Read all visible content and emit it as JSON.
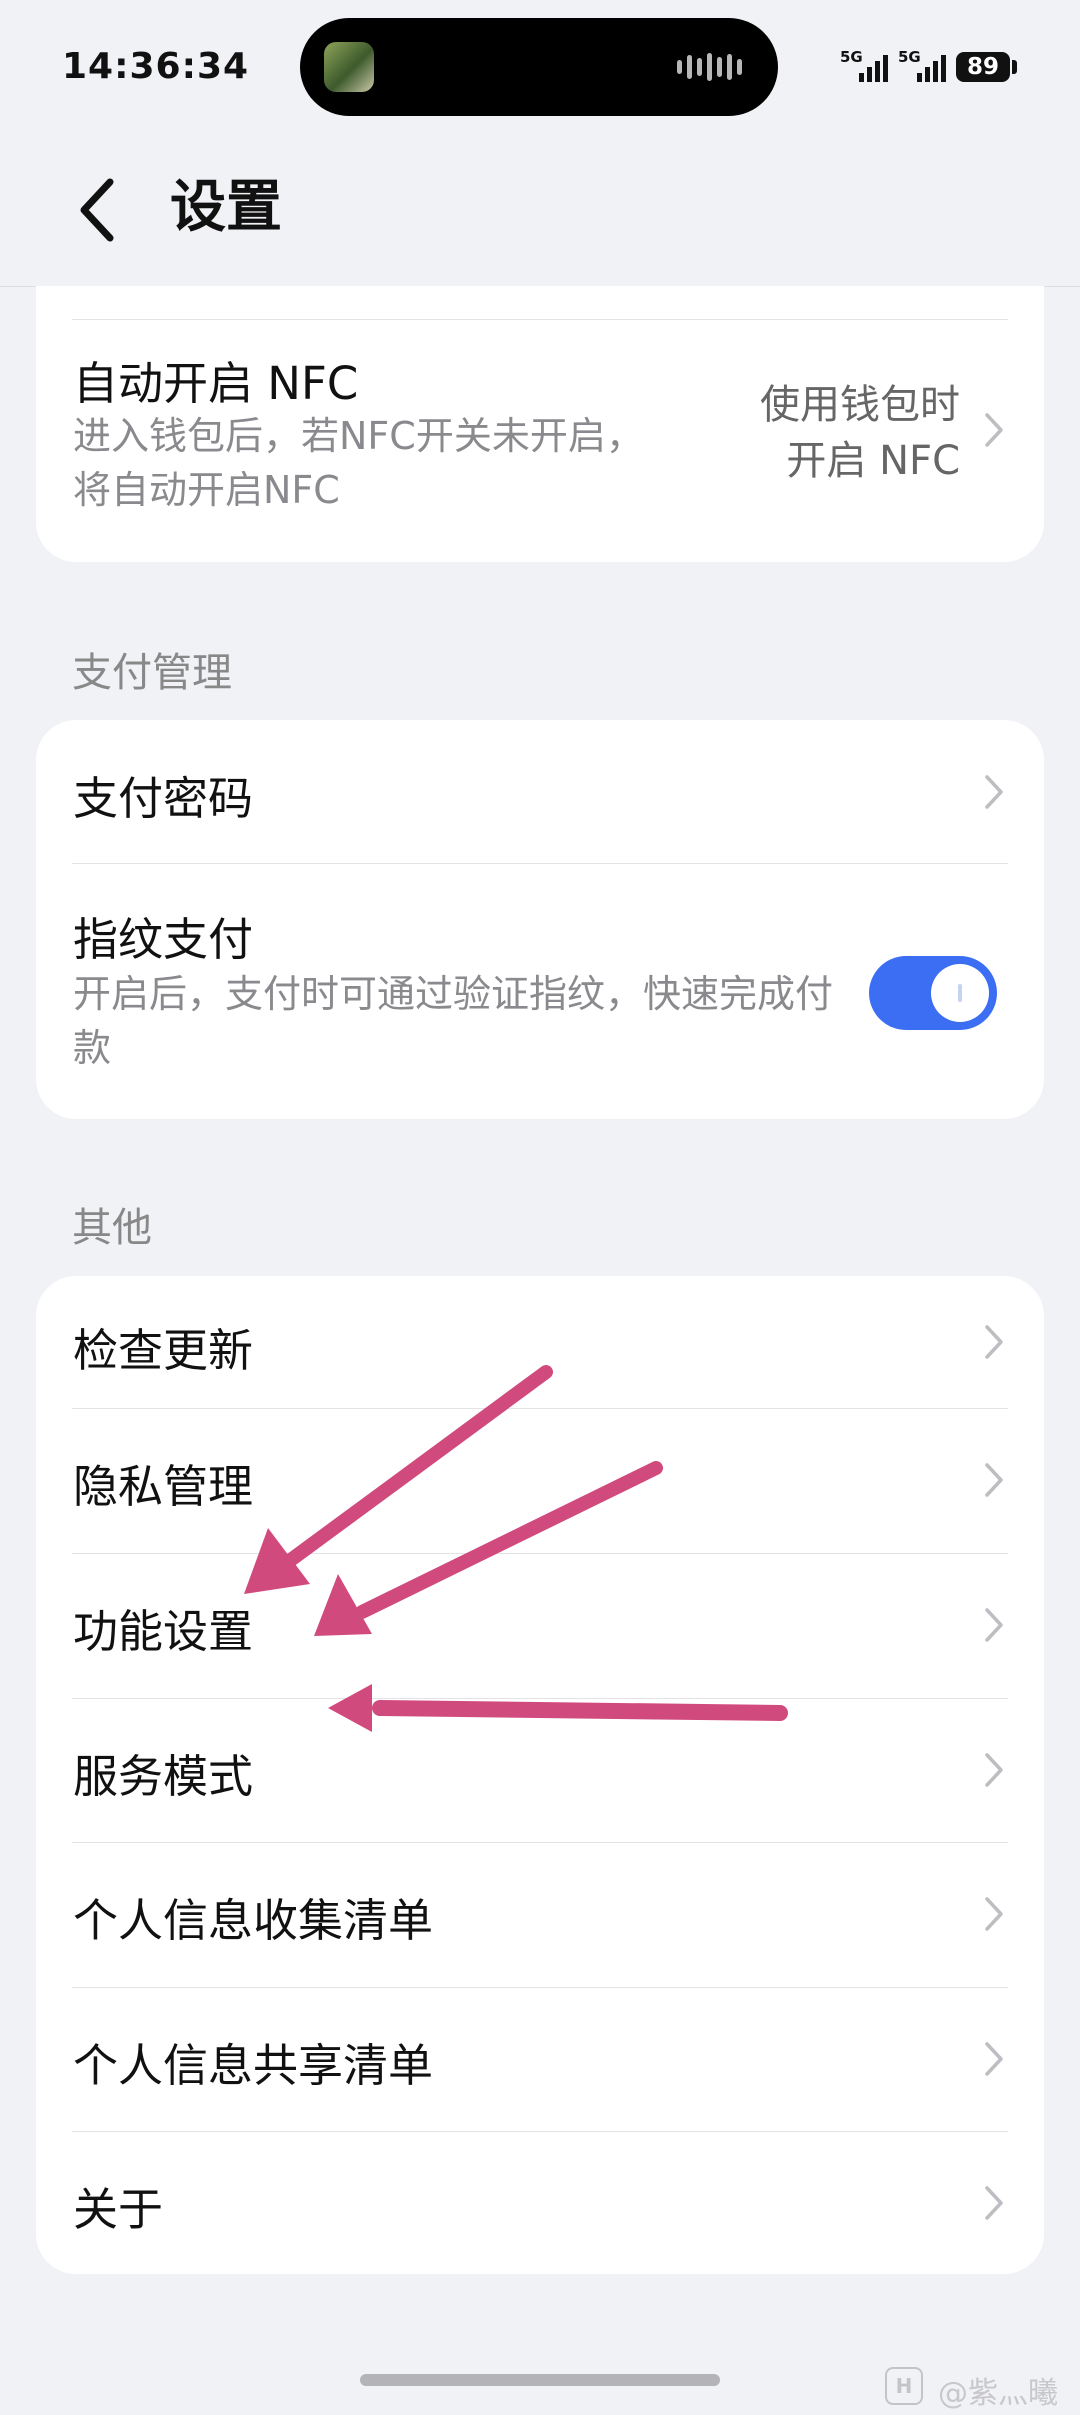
{
  "status_bar": {
    "time": "14:36:34",
    "battery": "89",
    "network_1": "5G",
    "network_2": "5G"
  },
  "nav": {
    "title": "设置",
    "back_icon": "chevron-left-icon"
  },
  "nfc_card": {
    "title": "自动开启 NFC",
    "desc": "进入钱包后，若NFC开关未开启，将自动开启NFC",
    "value_line1": "使用钱包时",
    "value_line2": "开启 NFC"
  },
  "payment": {
    "header": "支付管理",
    "items": [
      {
        "label": "支付密码"
      },
      {
        "label": "指纹支付",
        "desc": "开启后，支付时可通过验证指纹，快速完成付款",
        "toggle_on": true
      }
    ]
  },
  "other": {
    "header": "其他",
    "items": [
      {
        "label": "检查更新"
      },
      {
        "label": "隐私管理"
      },
      {
        "label": "功能设置"
      },
      {
        "label": "服务模式"
      },
      {
        "label": "个人信息收集清单"
      },
      {
        "label": "个人信息共享清单"
      },
      {
        "label": "关于"
      }
    ]
  },
  "watermark": {
    "logo": "H",
    "text": "@紫灬曦"
  },
  "colors": {
    "accent": "#3b6ef2",
    "arrow": "#d14a7e",
    "background": "#f1f2f6"
  }
}
